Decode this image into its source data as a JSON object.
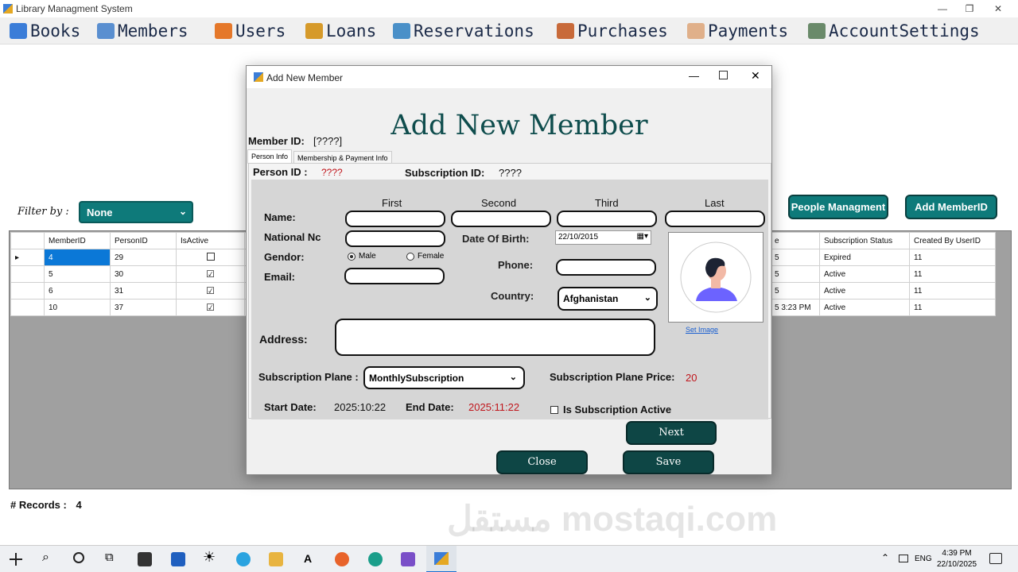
{
  "window": {
    "title": "Library Managment System",
    "min": "—",
    "max": "❐",
    "close": "✕"
  },
  "menu": [
    {
      "label": "Books",
      "icon": "books-icon",
      "color": "#3b7dd8"
    },
    {
      "label": "Members",
      "icon": "members-icon",
      "color": "#5a8fd0"
    },
    {
      "label": "Users",
      "icon": "users-icon",
      "color": "#e5782a"
    },
    {
      "label": "Loans",
      "icon": "loans-icon",
      "color": "#d69a2a"
    },
    {
      "label": "Reservations",
      "icon": "reservations-icon",
      "color": "#4a90c8"
    },
    {
      "label": "Purchases",
      "icon": "purchases-icon",
      "color": "#c86a3a"
    },
    {
      "label": "Payments",
      "icon": "payments-icon",
      "color": "#e0b08a"
    },
    {
      "label": "AccountSettings",
      "icon": "account-settings-icon",
      "color": "#6a8a6a"
    }
  ],
  "filter": {
    "label": "Filter by :",
    "value": "None"
  },
  "buttons": {
    "people": "People Managment",
    "add_member": "Add MemberID"
  },
  "grid": {
    "headers_left": [
      "",
      "MemberID",
      "PersonID",
      "IsActive"
    ],
    "headers_right": [
      "e",
      "Subscription Status",
      "Created By UserID"
    ],
    "rows": [
      {
        "member": "4",
        "person": "29",
        "active": false,
        "date": "5",
        "status": "Expired",
        "user": "11",
        "current": true
      },
      {
        "member": "5",
        "person": "30",
        "active": true,
        "date": "5",
        "status": "Active",
        "user": "11",
        "current": false
      },
      {
        "member": "6",
        "person": "31",
        "active": true,
        "date": "5",
        "status": "Active",
        "user": "11",
        "current": false
      },
      {
        "member": "10",
        "person": "37",
        "active": true,
        "date": "5 3:23 PM",
        "status": "Active",
        "user": "11",
        "current": false
      }
    ]
  },
  "records": {
    "label": "# Records :",
    "count": "4"
  },
  "dialog": {
    "title": "Add New Member",
    "heading": "Add New Member",
    "member_id_label": "Member ID:",
    "member_id_value": "[????]",
    "tabs": [
      "Person Info",
      "Membership & Payment Info"
    ],
    "person_id_label": "Person ID :",
    "person_id_value": "????",
    "subscription_id_label": "Subscription ID:",
    "subscription_id_value": "????",
    "name_cols": [
      "First",
      "Second",
      "Third",
      "Last"
    ],
    "labels": {
      "name": "Name:",
      "national": "National Nc",
      "gender": "Gendor:",
      "email": "Email:",
      "dob": "Date Of Birth:",
      "phone": "Phone:",
      "country": "Country:",
      "address": "Address:",
      "sub_plan": "Subscription Plane :",
      "sub_price": "Subscription Plane Price:",
      "start": "Start Date:",
      "end": "End Date:",
      "is_active": "Is Subscription Active"
    },
    "gender_options": [
      "Male",
      "Female"
    ],
    "dob_value": "22/10/2015",
    "country_value": "Afghanistan",
    "plan_value": "MonthlySubscription",
    "price_value": "20",
    "start_value": "2025:10:22",
    "end_value": "2025:11:22",
    "set_image": "Set Image",
    "next": "Next",
    "close": "Close",
    "save": "Save"
  },
  "taskbar": {
    "lang": "ENG",
    "time": "4:39 PM",
    "date": "22/10/2025"
  },
  "watermark": "مستقل mostaqi.com"
}
